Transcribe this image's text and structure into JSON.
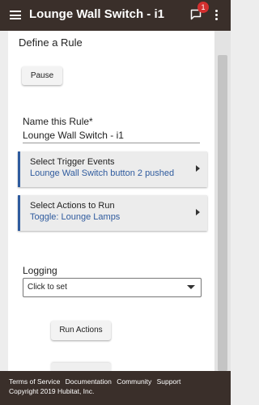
{
  "appbar": {
    "title": "Lounge Wall Switch - i1",
    "notification_count": "1",
    "icons": {
      "menu": "hamburger-menu-icon",
      "chat": "chat-bubble-icon",
      "more": "more-vert-icon"
    }
  },
  "rule": {
    "section_title": "Define a Rule",
    "pause_label": "Pause",
    "name_label": "Name this Rule*",
    "name_value": "Lounge Wall Switch - i1",
    "trigger": {
      "title": "Select Trigger Events",
      "value": "Lounge Wall Switch button 2 pushed"
    },
    "actions": {
      "title": "Select Actions to Run",
      "value": "Toggle: Lounge Lamps"
    },
    "logging_label": "Logging",
    "logging_value": "Click to set",
    "run_actions_label": "Run Actions"
  },
  "footer": {
    "links": [
      "Terms of Service",
      "Documentation",
      "Community",
      "Support"
    ],
    "copyright": "Copyright 2019 Hubitat, Inc."
  },
  "colors": {
    "appbar": "#3a2f2a",
    "accent": "#2f5b9e",
    "badge": "#d32f2f"
  }
}
